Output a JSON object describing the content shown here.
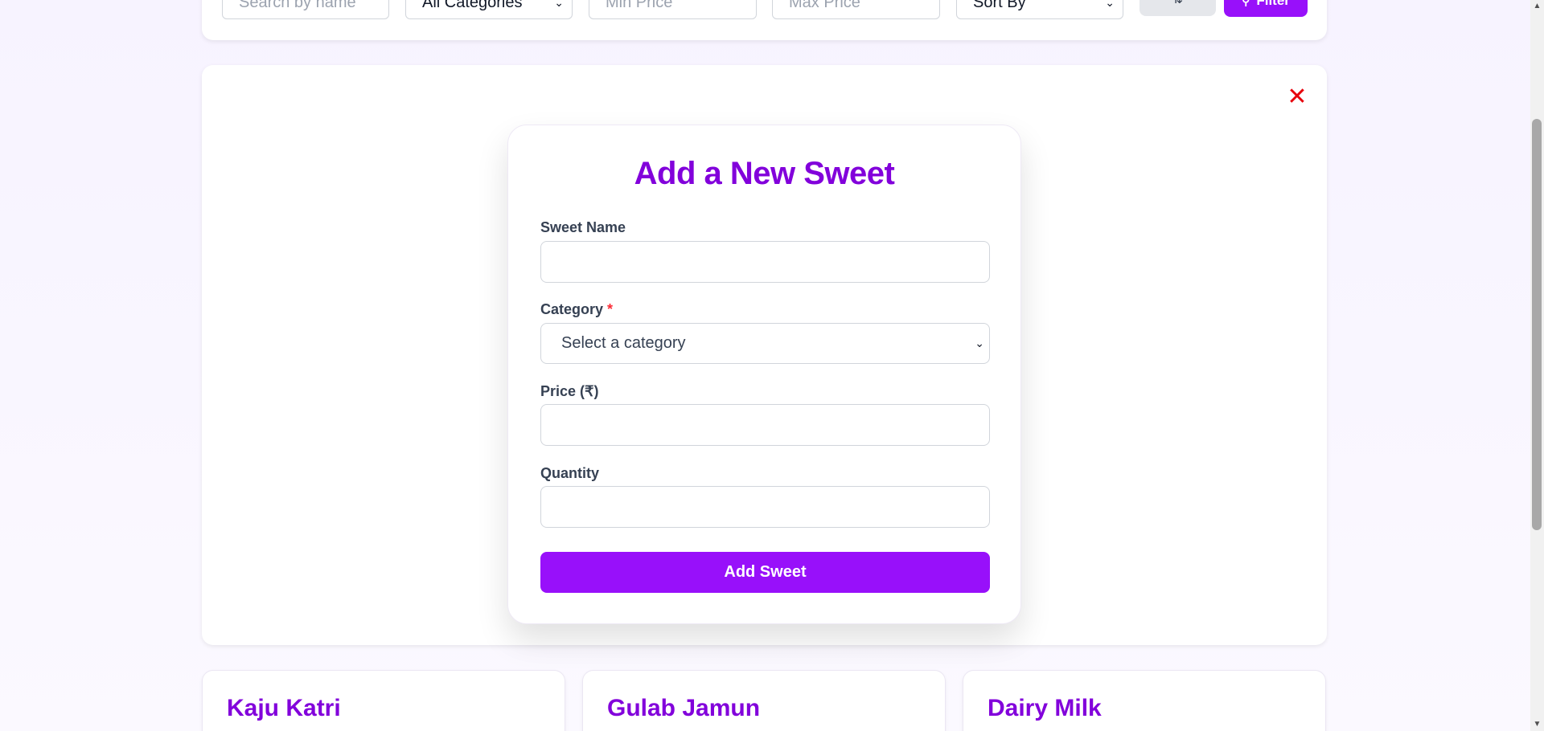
{
  "filter_bar": {
    "search_placeholder": "Search by name",
    "category_selected": "All Categories",
    "min_price_placeholder": "Min Price",
    "max_price_placeholder": "Max Price",
    "sort_selected": "Sort By",
    "sort_order_icon": "sort-order-icon",
    "filter_label": "Filter",
    "filter_icon": "search-icon"
  },
  "panel": {
    "close_icon": "close-icon",
    "title": "Add a New Sweet",
    "fields": {
      "name_label": "Sweet Name",
      "category_label": "Category",
      "category_required": "*",
      "category_placeholder": "Select a category",
      "price_label": "Price (₹)",
      "quantity_label": "Quantity"
    },
    "submit_label": "Add Sweet"
  },
  "products": [
    {
      "name": "Kaju Katri"
    },
    {
      "name": "Gulab Jamun"
    },
    {
      "name": "Dairy Milk"
    }
  ],
  "colors": {
    "accent": "#9810fa",
    "title": "#8200db",
    "danger": "#e7000b",
    "background": "#f8f5ff"
  }
}
